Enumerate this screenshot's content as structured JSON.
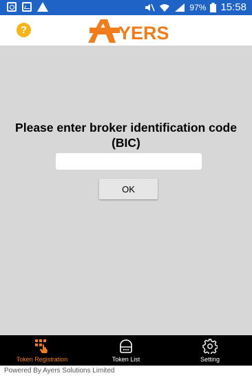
{
  "status_bar": {
    "battery": "97%",
    "time": "15:58"
  },
  "header": {
    "help_icon": "help-icon",
    "logo_text": "YERS",
    "brand_color": "#f07d1c"
  },
  "main": {
    "prompt": "Please enter broker identification code (BIC)",
    "bic_value": "",
    "ok_label": "OK"
  },
  "nav": {
    "items": [
      {
        "label": "Token Registration",
        "icon": "keypad-hand-icon",
        "active": true
      },
      {
        "label": "Token List",
        "icon": "token-icon",
        "active": false
      },
      {
        "label": "Setting",
        "icon": "gear-icon",
        "active": false
      }
    ]
  },
  "footer": {
    "text": "Powered By Ayers Solutions Limited"
  }
}
